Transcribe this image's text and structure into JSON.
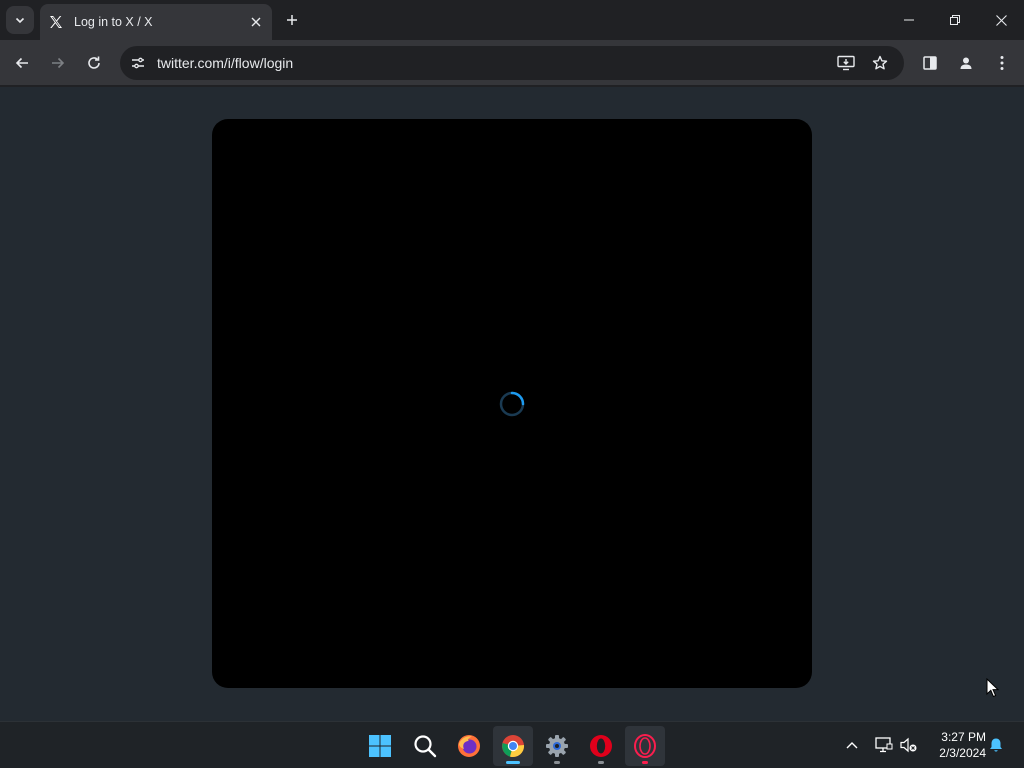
{
  "browser": {
    "tab": {
      "title": "Log in to X / X",
      "favicon": "x-logo-icon"
    },
    "address_bar": {
      "url": "twitter.com/i/flow/login"
    }
  },
  "page": {
    "modal": {
      "state": "loading",
      "spinner_color": "#1d9bf0"
    }
  },
  "taskbar": {
    "apps": [
      {
        "name": "start-button"
      },
      {
        "name": "search"
      },
      {
        "name": "firefox"
      },
      {
        "name": "chrome",
        "active": true
      },
      {
        "name": "settings"
      },
      {
        "name": "opera"
      },
      {
        "name": "opera-gx"
      }
    ],
    "clock": {
      "time": "3:27 PM",
      "date": "2/3/2024"
    }
  },
  "colors": {
    "accent": "#4cc2ff",
    "page_bg": "#232a31",
    "modal_bg": "#000000"
  }
}
